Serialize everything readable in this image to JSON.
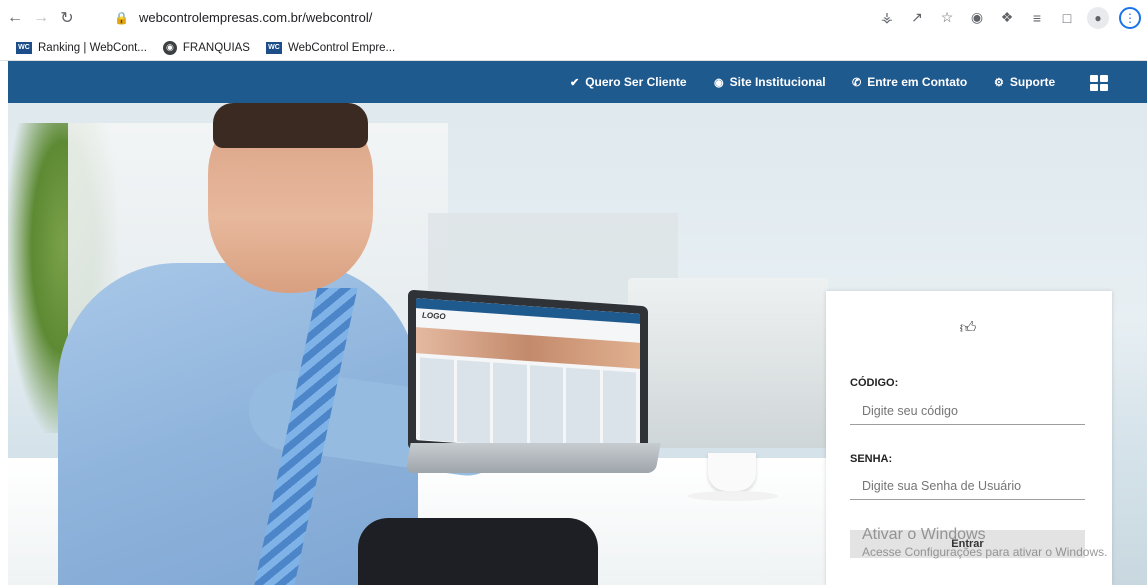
{
  "browser": {
    "url": "webcontrolempresas.com.br/webcontrol/",
    "icons": [
      "back-icon",
      "forward-icon",
      "reload-icon",
      "lock-icon",
      "key-icon",
      "share-icon",
      "star-icon",
      "camera-icon",
      "extensions-icon",
      "reading-list-icon",
      "side-panel-icon",
      "profile-icon",
      "menu-icon"
    ]
  },
  "bookmarks": [
    {
      "label": "Ranking | WebCont...",
      "icon": "wc-favicon"
    },
    {
      "label": "FRANQUIAS",
      "icon": "globe-icon"
    },
    {
      "label": "WebControl Empre...",
      "icon": "wc-favicon"
    }
  ],
  "site_nav": {
    "items": [
      {
        "label": "Quero Ser Cliente",
        "icon": "check-icon"
      },
      {
        "label": "Site Institucional",
        "icon": "globe-icon"
      },
      {
        "label": "Entre em Contato",
        "icon": "phone-icon"
      },
      {
        "label": "Suporte",
        "icon": "gear-icon"
      }
    ],
    "color": "#1f5a8f"
  },
  "login": {
    "code_label": "CÓDIGO:",
    "code_placeholder": "Digite seu código",
    "password_label": "SENHA:",
    "password_placeholder": "Digite sua Senha de Usuário",
    "submit_label": "Entrar"
  },
  "watermark": {
    "title": "Ativar o Windows",
    "subtitle": "Acesse Configurações para ativar o Windows."
  },
  "laptop_screen": {
    "logo_text": "LOGO"
  }
}
